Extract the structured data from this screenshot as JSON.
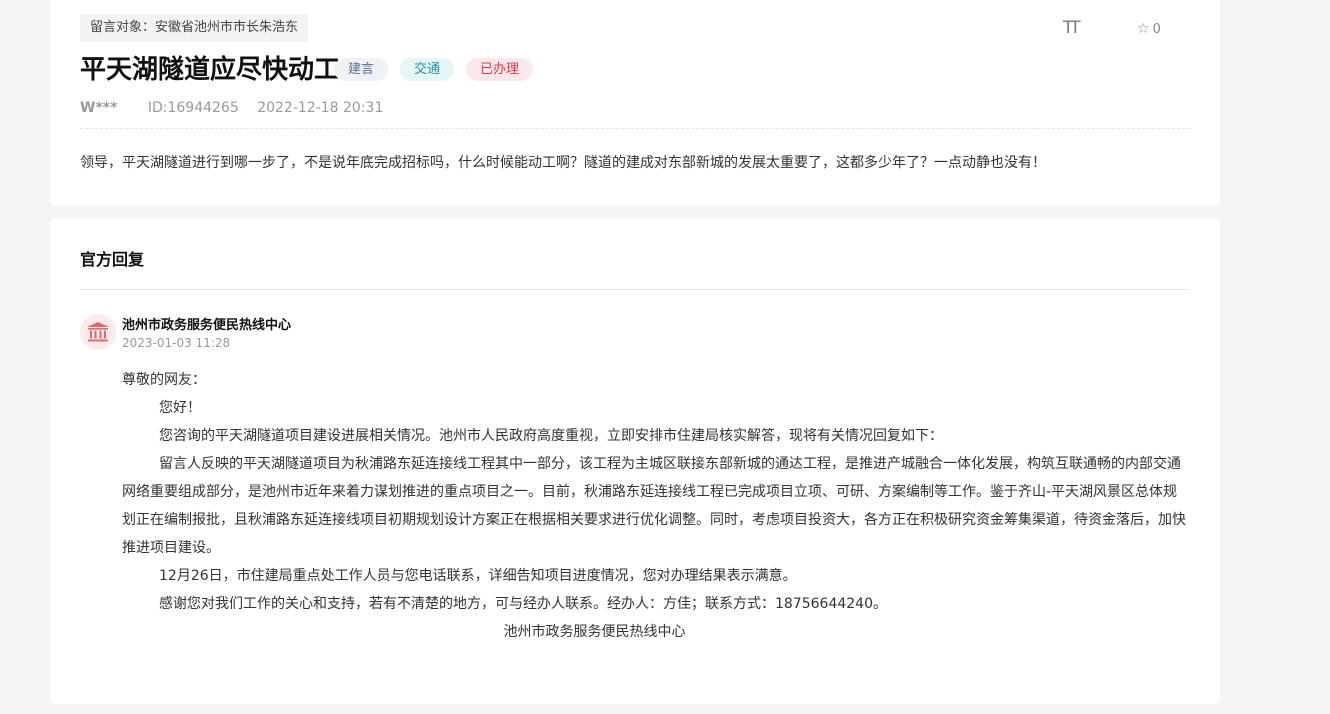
{
  "message": {
    "target": "留言对象：安徽省池州市市长朱浩东",
    "font_toggle": "TT",
    "favorite_count": "0",
    "title": "平天湖隧道应尽快动工",
    "tags": {
      "type": "建言",
      "category": "交通",
      "status": "已办理"
    },
    "user": "W***",
    "id": "ID:16944265",
    "time": "2022-12-18 20:31",
    "content": "领导，平天湖隧道进行到哪一步了，不是说年底完成招标吗，什么时候能动工啊？隧道的建成对东部新城的发展太重要了，这都多少年了？一点动静也没有！"
  },
  "reply": {
    "heading": "官方回复",
    "org": "池州市政务服务便民热线中心",
    "time": "2023-01-03 11:28",
    "paragraphs": {
      "salutation": "尊敬的网友：",
      "greeting": "您好！",
      "p1": "您咨询的平天湖隧道项目建设进展相关情况。池州市人民政府高度重视，立即安排市住建局核实解答，现将有关情况回复如下：",
      "p2": "留言人反映的平天湖隧道项目为秋浦路东延连接线工程其中一部分，该工程为主城区联接东部新城的通达工程，是推进产城融合一体化发展，构筑互联通畅的内部交通网络重要组成部分，是池州市近年来着力谋划推进的重点项目之一。目前，秋浦路东延连接线工程已完成项目立项、可研、方案编制等工作。鉴于齐山-平天湖风景区总体规划正在编制报批，且秋浦路东延连接线项目初期规划设计方案正在根据相关要求进行优化调整。同时，考虑项目投资大，各方正在积极研究资金筹集渠道，待资金落后，加快推进项目建设。",
      "p3": "12月26日，市住建局重点处工作人员与您电话联系，详细告知项目进度情况，您对办理结果表示满意。",
      "p4": "感谢您对我们工作的关心和支持，若有不清楚的地方，可与经办人联系。经办人：方佳；联系方式：18756644240。",
      "signature": "池州市政务服务便民热线中心"
    }
  },
  "colors": {
    "page_bg": "#f4f5f7",
    "status_red": "#d9384e",
    "category_teal": "#2b8fa4",
    "type_blue": "#5a6f8c",
    "avatar_bg": "#fdeaea",
    "avatar_icon": "#e06a6a"
  },
  "icons": {
    "font_size": "font-size-icon",
    "favorite": "star-outline-icon",
    "avatar": "government-building-icon"
  }
}
